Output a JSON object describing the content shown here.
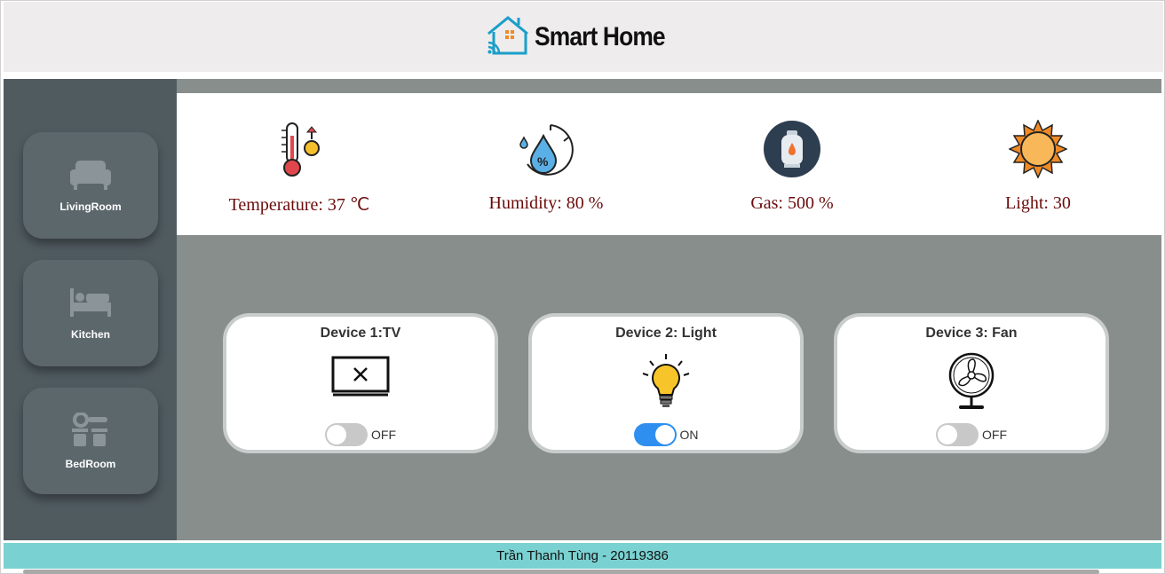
{
  "header": {
    "title": "Smart Home",
    "logo_icon": "smart-home-logo-icon"
  },
  "sidebar": {
    "items": [
      {
        "label": "LivingRoom",
        "icon": "sofa-icon"
      },
      {
        "label": "Kitchen",
        "icon": "bed-icon"
      },
      {
        "label": "BedRoom",
        "icon": "kitchen-icon"
      }
    ]
  },
  "sensors": [
    {
      "label": "Temperature: 37 ℃",
      "icon": "thermometer-icon"
    },
    {
      "label": "Humidity: 80 %",
      "icon": "humidity-icon"
    },
    {
      "label": "Gas: 500 %",
      "icon": "gas-cylinder-icon"
    },
    {
      "label": "Light: 30",
      "icon": "sun-icon"
    }
  ],
  "devices": [
    {
      "title": "Device 1:TV",
      "state": "OFF",
      "icon": "tv-icon"
    },
    {
      "title": "Device 2: Light",
      "state": "ON",
      "icon": "light-bulb-icon"
    },
    {
      "title": "Device 3: Fan",
      "state": "OFF",
      "icon": "fan-icon"
    }
  ],
  "footer": {
    "text": "Trần Thanh Tùng - 20119386"
  },
  "colors": {
    "header_bg": "#eeeced",
    "sidebar_bg": "#505b60",
    "main_bg": "#878e8b",
    "sensor_text": "#6b0b0b",
    "toggle_on": "#2f8ff0",
    "footer_bg": "#7ad1d1"
  }
}
